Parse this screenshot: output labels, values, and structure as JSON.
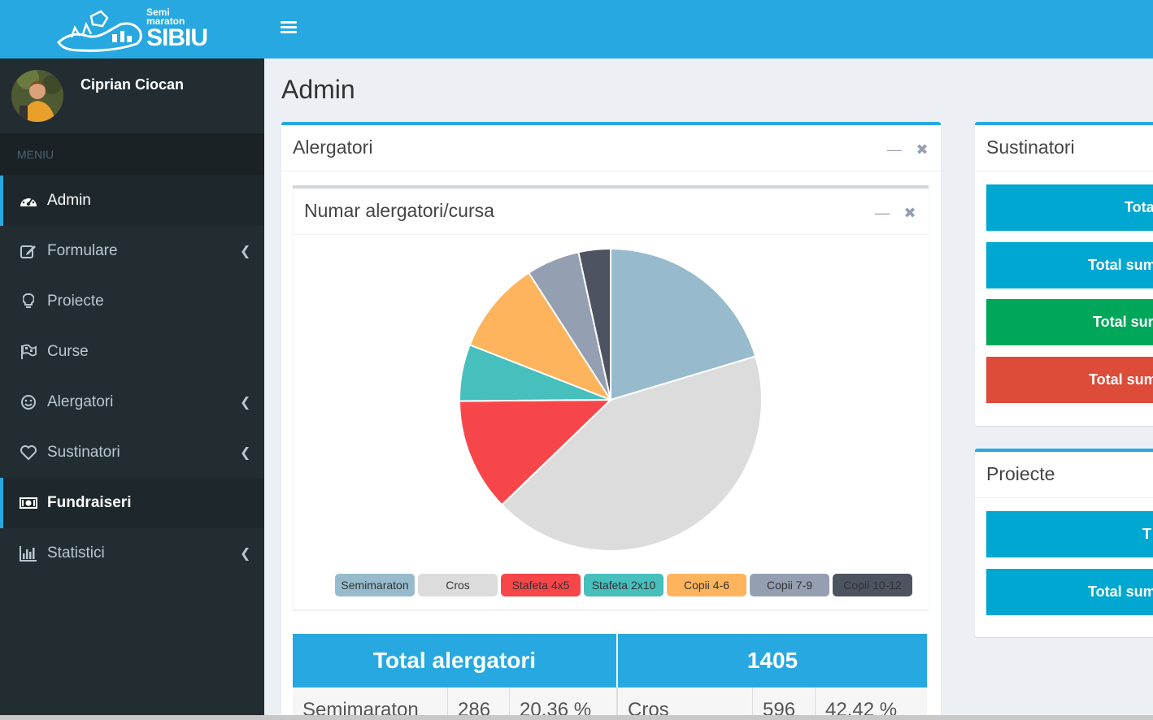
{
  "brand": {
    "line1": "Semi",
    "line2": "maraton",
    "name": "SIBIU"
  },
  "user": {
    "name": "Ciprian Ciocan"
  },
  "menu": {
    "header": "MENIU",
    "items": [
      {
        "label": "Admin",
        "icon": "dashboard-icon",
        "active": true,
        "chevron": false
      },
      {
        "label": "Formulare",
        "icon": "edit-icon",
        "active": false,
        "chevron": true
      },
      {
        "label": "Proiecte",
        "icon": "lightbulb-icon",
        "active": false,
        "chevron": false
      },
      {
        "label": "Curse",
        "icon": "flag-checkered-icon",
        "active": false,
        "chevron": false
      },
      {
        "label": "Alergatori",
        "icon": "smile-icon",
        "active": false,
        "chevron": true
      },
      {
        "label": "Sustinatori",
        "icon": "heart-icon",
        "active": false,
        "chevron": true
      },
      {
        "label": "Fundraiseri",
        "icon": "money-icon",
        "active": true,
        "chevron": false
      },
      {
        "label": "Statistici",
        "icon": "bar-chart-icon",
        "active": false,
        "chevron": true
      }
    ]
  },
  "page": {
    "title": "Admin"
  },
  "alergatori_box": {
    "title": "Alergatori",
    "chart_title": "Numar alergatori/cursa"
  },
  "chart_data": {
    "type": "pie",
    "title": "Numar alergatori/cursa",
    "categories": [
      "Semimaraton",
      "Cros",
      "Stafeta 4x5",
      "Stafeta 2x10",
      "Copii 4-6",
      "Copii 7-9",
      "Copii 10-12"
    ],
    "values": [
      286,
      596,
      170,
      85,
      140,
      80,
      48
    ],
    "colors": [
      "#97bbcd",
      "#dcdcdc",
      "#f7464a",
      "#46bfbd",
      "#fdb45c",
      "#949fb1",
      "#4d5360"
    ],
    "legend_position": "bottom"
  },
  "summary": {
    "header_label": "Total alergatori",
    "header_value": "1405",
    "row": [
      {
        "label": "Semimaraton",
        "count": "286",
        "pct": "20.36 %"
      },
      {
        "label": "Cros",
        "count": "596",
        "pct": "42.42 %"
      }
    ]
  },
  "sustinatori_box": {
    "title": "Sustinatori",
    "buttons": [
      {
        "label": "Tota",
        "color": "#00a7d0"
      },
      {
        "label": "Total sum",
        "color": "#00a7d0"
      },
      {
        "label": "Total sur",
        "color": "#00a65a"
      },
      {
        "label": "Total sum",
        "color": "#dd4b39"
      }
    ]
  },
  "proiecte_box": {
    "title": "Proiecte",
    "buttons": [
      {
        "label": "T",
        "color": "#00a7d0"
      },
      {
        "label": "Total sum",
        "color": "#00a7d0"
      }
    ]
  }
}
